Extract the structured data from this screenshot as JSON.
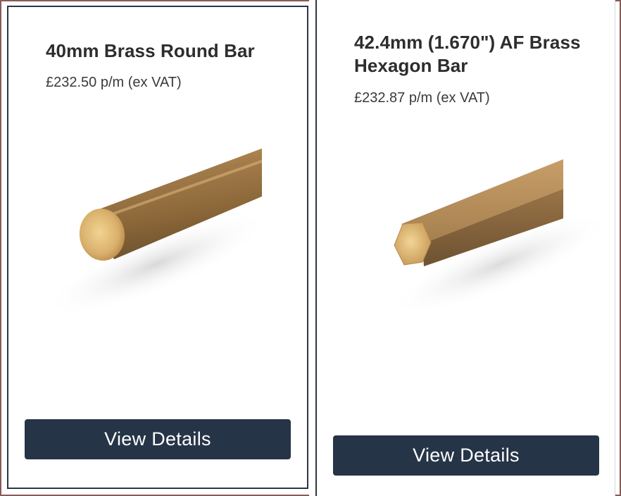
{
  "products": [
    {
      "title": "40mm Brass Round Bar",
      "price": "£232.50 p/m (ex VAT)",
      "image_icon": "brass-round-bar-image",
      "button_label": "View Details"
    },
    {
      "title": "42.4mm (1.670\") AF Brass Hexagon Bar",
      "price": "£232.87 p/m (ex VAT)",
      "image_icon": "brass-hexagon-bar-image",
      "button_label": "View Details"
    }
  ],
  "colors": {
    "button_bg": "#263447",
    "button_text": "#ffffff",
    "title_text": "#2d2d2d",
    "card_border": "#2b3545",
    "brass_light": "#e6c27f",
    "brass_dark": "#8a6638"
  }
}
